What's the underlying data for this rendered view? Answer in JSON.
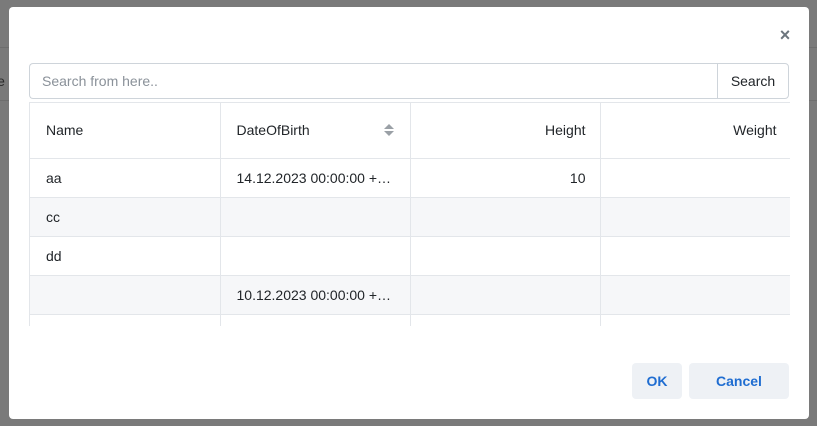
{
  "background": {
    "fragment_text": "le"
  },
  "dialog": {
    "close_symbol": "×",
    "search": {
      "placeholder": "Search from here..",
      "value": "",
      "button_label": "Search"
    },
    "grid": {
      "columns": [
        {
          "label": "Name",
          "align": "left",
          "sortable": false
        },
        {
          "label": "DateOfBirth",
          "align": "left",
          "sortable": true
        },
        {
          "label": "Height",
          "align": "right",
          "sortable": false
        },
        {
          "label": "Weight",
          "align": "right",
          "sortable": false
        }
      ],
      "rows": [
        [
          "aa",
          "14.12.2023 00:00:00 +0...",
          "10",
          ""
        ],
        [
          "cc",
          "",
          "",
          ""
        ],
        [
          "dd",
          "",
          "",
          ""
        ],
        [
          "",
          "10.12.2023 00:00:00 +0...",
          "",
          ""
        ],
        [
          "",
          "",
          "",
          ""
        ]
      ]
    },
    "buttons": {
      "ok": "OK",
      "cancel": "Cancel"
    }
  },
  "colors": {
    "overlay": "#7a7a7a",
    "accent": "#1f6dd1",
    "button_bg": "#eef1f5",
    "alt_row": "#f6f7f9"
  }
}
